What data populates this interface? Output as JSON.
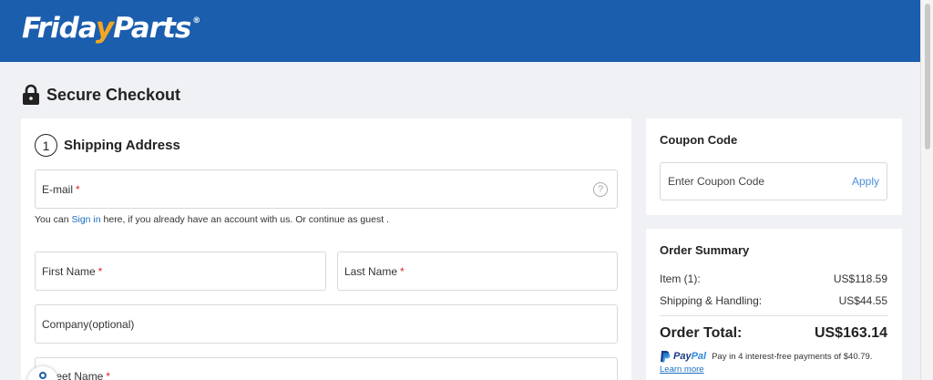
{
  "header": {
    "logo_part1": "Frida",
    "logo_part2": "y",
    "logo_part3": "Parts",
    "logo_reg": "®",
    "brand_color": "#1b5eae",
    "accent_color": "#f5a623"
  },
  "page": {
    "title": "Secure Checkout",
    "title_icon": "lock-icon"
  },
  "shipping": {
    "step_number": "1",
    "title": "Shipping Address",
    "email_label": "E-mail",
    "required_mark": "*",
    "help_symbol": "?",
    "note_prefix": "You can ",
    "note_link": "Sign in",
    "note_suffix": " here, if you already have an account with us. Or continue as guest .",
    "first_name_label": "First Name",
    "last_name_label": "Last Name",
    "company_label": "Company(optional)",
    "street_label": "Street Name"
  },
  "coupon": {
    "title": "Coupon Code",
    "placeholder": "Enter Coupon Code",
    "apply_label": "Apply"
  },
  "summary": {
    "title": "Order Summary",
    "item_label": "Item (1):",
    "item_value": "US$118.59",
    "shipping_label": "Shipping & Handling:",
    "shipping_value": "US$44.55",
    "total_label": "Order Total:",
    "total_value": "US$163.14",
    "paypal_word1": "Pay",
    "paypal_word2": "Pal",
    "paypal_text": "Pay in 4 interest-free payments of $40.79.",
    "learn_more": "Learn more"
  }
}
